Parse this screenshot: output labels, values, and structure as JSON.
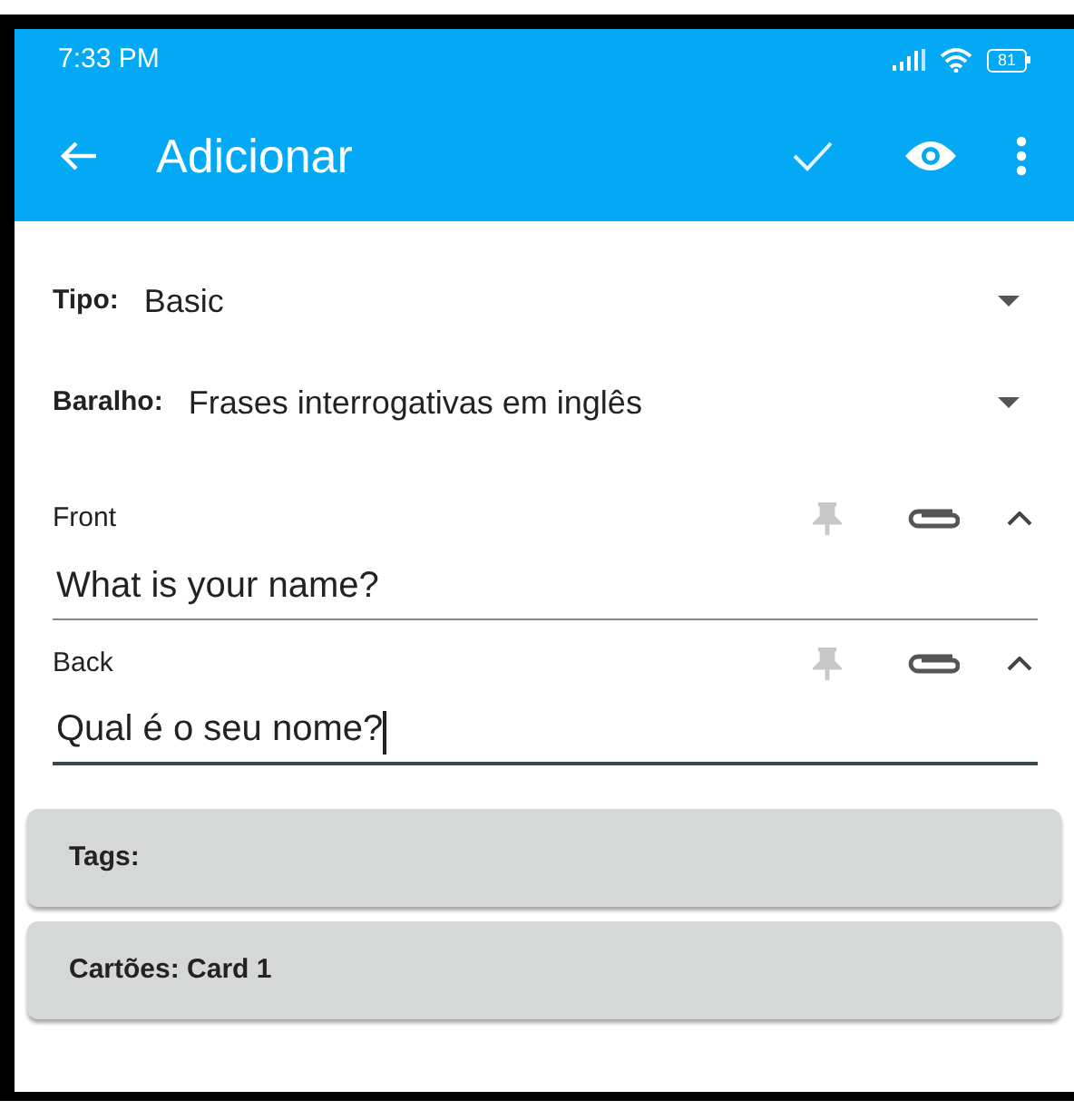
{
  "status_bar": {
    "time": "7:33 PM",
    "battery": "81"
  },
  "toolbar": {
    "title": "Adicionar"
  },
  "selectors": [
    {
      "label": "Tipo:",
      "value": "Basic"
    },
    {
      "label": "Baralho:",
      "value": "Frases interrogativas em inglês"
    }
  ],
  "fields": [
    {
      "label": "Front",
      "value": "What is your name?",
      "focused": false,
      "sticky": false
    },
    {
      "label": "Back",
      "value": "Qual é o seu nome?",
      "focused": true,
      "sticky": false
    }
  ],
  "cards": [
    {
      "text": "Tags:"
    },
    {
      "text": "Cartões: Card 1"
    }
  ]
}
